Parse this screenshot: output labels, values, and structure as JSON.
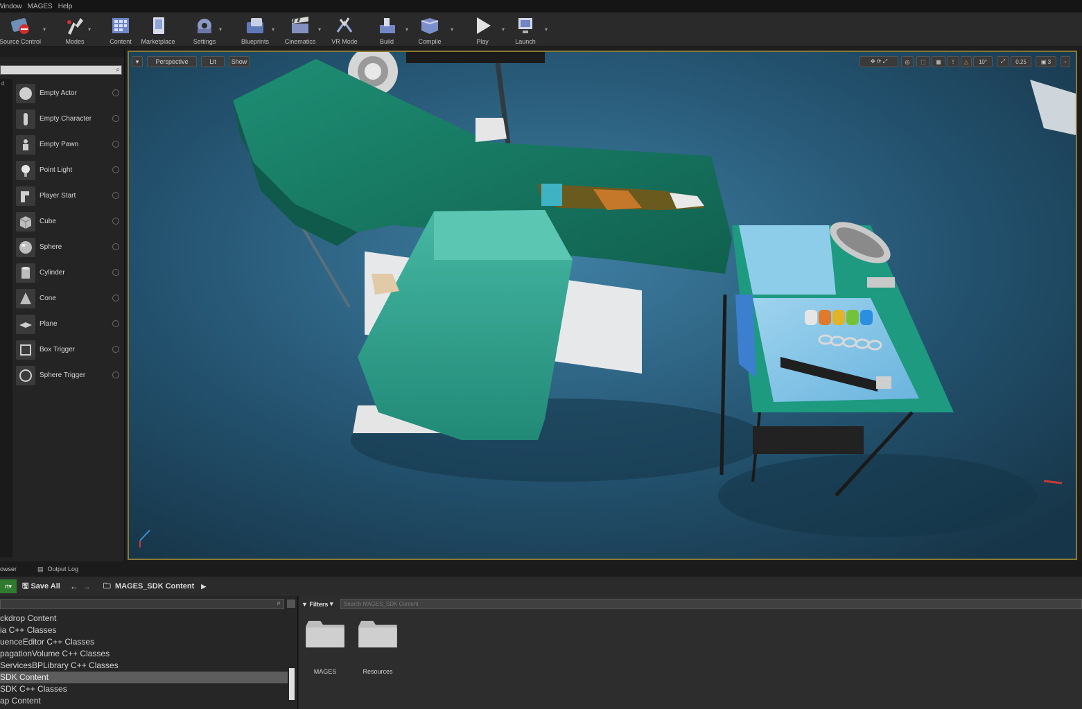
{
  "menu": [
    "Window",
    "MAGES",
    "Help"
  ],
  "toolbar": {
    "buttons": [
      {
        "label": "Source Control",
        "icon": "source-control-icon"
      },
      {
        "label": "Modes",
        "icon": "modes-icon"
      },
      {
        "label": "Content",
        "icon": "content-icon"
      },
      {
        "label": "Marketplace",
        "icon": "marketplace-icon"
      },
      {
        "label": "Settings",
        "icon": "settings-icon"
      },
      {
        "label": "Blueprints",
        "icon": "blueprints-icon"
      },
      {
        "label": "Cinematics",
        "icon": "cinematics-icon"
      },
      {
        "label": "VR Mode",
        "icon": "vr-mode-icon"
      },
      {
        "label": "Build",
        "icon": "build-icon"
      },
      {
        "label": "Compile",
        "icon": "compile-icon"
      },
      {
        "label": "Play",
        "icon": "play-icon"
      },
      {
        "label": "Launch",
        "icon": "launch-icon"
      }
    ]
  },
  "place_panel": {
    "category_label": "d",
    "items": [
      {
        "label": "Empty Actor"
      },
      {
        "label": "Empty Character"
      },
      {
        "label": "Empty Pawn"
      },
      {
        "label": "Point Light"
      },
      {
        "label": "Player Start"
      },
      {
        "label": "Cube"
      },
      {
        "label": "Sphere"
      },
      {
        "label": "Cylinder"
      },
      {
        "label": "Cone"
      },
      {
        "label": "Plane"
      },
      {
        "label": "Box Trigger"
      },
      {
        "label": "Sphere Trigger"
      }
    ]
  },
  "viewport": {
    "perspective_label": "Perspective",
    "lit_label": "Lit",
    "show_label": "Show",
    "snap_angle": "10°",
    "scale_snap": "0.25",
    "camera_speed": "3"
  },
  "lower_tabs": {
    "content_browser": "owser",
    "output_log": "Output Log"
  },
  "content_browser": {
    "import_label": "rt",
    "save_all": "Save All",
    "breadcrumb": "MAGES_SDK Content",
    "filters_label": "Filters",
    "search_placeholder": "Search MAGES_SDK Content",
    "tree": [
      "ckdrop Content",
      "ia C++ Classes",
      "uenceEditor C++ Classes",
      "pagationVolume C++ Classes",
      "ServicesBPLibrary C++ Classes",
      "SDK Content",
      "SDK C++ Classes",
      "ap Content"
    ],
    "selected_index": 5,
    "folders": [
      {
        "label": "MAGES"
      },
      {
        "label": "Resources"
      }
    ]
  },
  "colors": {
    "accent_frame": "#8a7a35",
    "import_green": "#2f7a2f",
    "surgical_drape": "#1f8a72",
    "floor": "#214a63"
  }
}
